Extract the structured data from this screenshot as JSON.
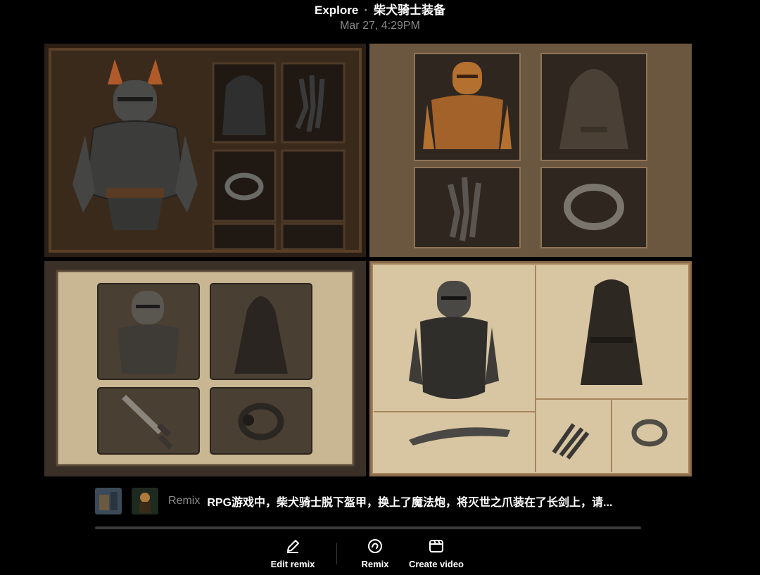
{
  "header": {
    "title": "Explore",
    "separator": "·",
    "subtitle": "柴犬骑士装备",
    "date": "Mar 27, 4:29PM"
  },
  "gallery": {
    "panels": [
      {
        "items": [
          "armor",
          "cloak",
          "claw",
          "ring"
        ]
      },
      {
        "items": [
          "armor",
          "robe",
          "claw",
          "ring"
        ]
      },
      {
        "items": [
          "armor",
          "cloak",
          "sword",
          "ring"
        ]
      },
      {
        "items": [
          "armor",
          "robe",
          "blade",
          "claw",
          "ring"
        ]
      }
    ]
  },
  "caption": {
    "remix_label": "Remix",
    "prompt": "RPG游戏中，柴犬骑士脱下盔甲，换上了魔法炮，将灭世之爪装在了长剑上，请..."
  },
  "actions": {
    "edit_remix": "Edit remix",
    "remix": "Remix",
    "create_video": "Create video"
  },
  "icons": {
    "edit": "pencil-icon",
    "remix": "remix-icon",
    "video": "video-icon"
  },
  "colors": {
    "background": "#000000",
    "muted_text": "#8a8a8a",
    "progress_track": "#3b3b3b"
  }
}
